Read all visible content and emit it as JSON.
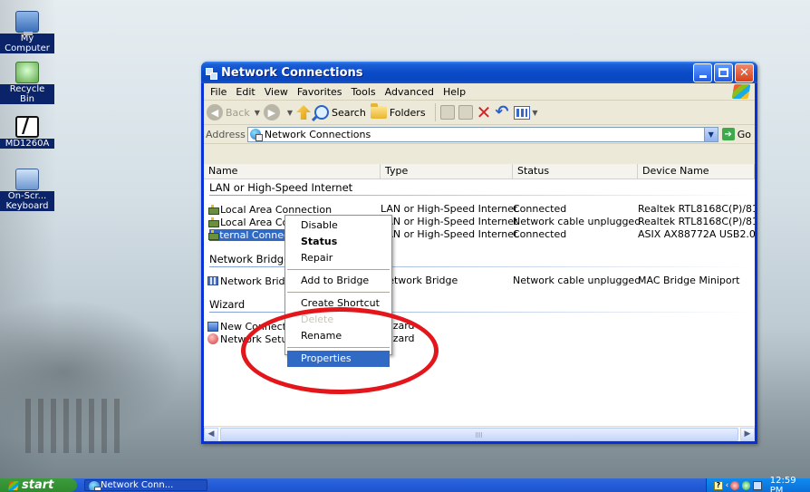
{
  "desktop": {
    "icons": [
      {
        "label": "My Computer",
        "icon": "my-computer-icon"
      },
      {
        "label": "Recycle Bin",
        "icon": "recycle-bin-icon"
      },
      {
        "label": "MD1260A",
        "icon": "md1260a-icon"
      },
      {
        "label": "On-Scr... Keyboard",
        "icon": "keyboard-icon"
      }
    ]
  },
  "window": {
    "title": "Network Connections",
    "menu": [
      "File",
      "Edit",
      "View",
      "Favorites",
      "Tools",
      "Advanced",
      "Help"
    ],
    "toolbar": {
      "back": "Back",
      "search": "Search",
      "folders": "Folders"
    },
    "address": {
      "label": "Address",
      "value": "Network Connections",
      "go": "Go"
    },
    "columns": [
      "Name",
      "Type",
      "Status",
      "Device Name"
    ],
    "groups": [
      {
        "title": "LAN or High-Speed Internet",
        "items": [
          {
            "name": "Local Area Connection",
            "type": "LAN or High-Speed Internet",
            "status": "Connected",
            "device": "Realtek RTL8168C(P)/81",
            "icon": "lan-connection-icon"
          },
          {
            "name": "Local Area Connection 2",
            "type": "LAN or High-Speed Internet",
            "status": "Network cable unplugged",
            "device": "Realtek RTL8168C(P)/81",
            "icon": "lan-connection-icon"
          },
          {
            "name": "Internal Connection (Don't Change)",
            "type": "LAN or High-Speed Internet",
            "status": "Connected",
            "device": "ASIX AX88772A USB2.0",
            "icon": "lan-connection-icon",
            "selected": true
          }
        ]
      },
      {
        "title": "Network Bridge",
        "items": [
          {
            "name": "Network Bridge",
            "type": "Network Bridge",
            "status": "Network cable unplugged",
            "device": "MAC Bridge Miniport",
            "icon": "network-bridge-icon"
          }
        ]
      },
      {
        "title": "Wizard",
        "items": [
          {
            "name": "New Connection Wizard",
            "type": "Wizard",
            "status": "",
            "device": "",
            "icon": "new-connection-wizard-icon"
          },
          {
            "name": "Network Setup Wizard",
            "type": "Wizard",
            "status": "",
            "device": "",
            "icon": "network-setup-wizard-icon"
          }
        ]
      }
    ]
  },
  "context_menu": {
    "items": [
      "Disable",
      "Status",
      "Repair",
      "Add to Bridge",
      "Create Shortcut",
      "Delete",
      "Rename",
      "Properties"
    ],
    "highlighted": "Properties"
  },
  "taskbar": {
    "start": "start",
    "task": "Network Conn...",
    "clock": "12:59 PM"
  },
  "colors": {
    "selection": "#316ac5",
    "annotation": "#e3161b",
    "titlebar": "#0a4bc9"
  }
}
